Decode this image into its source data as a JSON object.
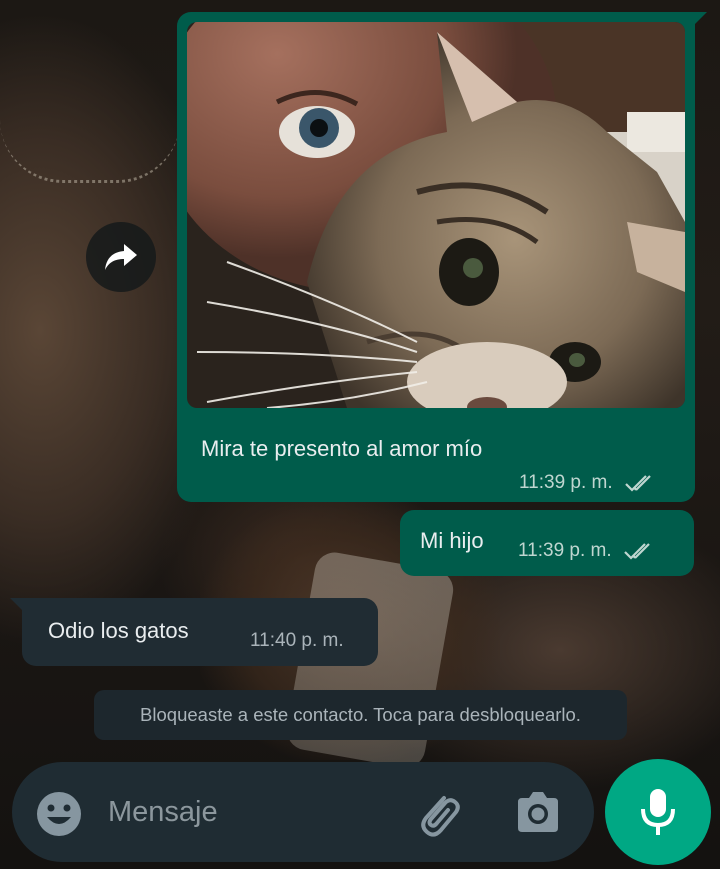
{
  "chat": {
    "messages": [
      {
        "direction": "outgoing",
        "type": "photo",
        "caption": "Mira te presento al amor mío",
        "time": "11:39 p. m.",
        "status": "delivered-double-check"
      },
      {
        "direction": "outgoing",
        "type": "text",
        "text": "Mi hijo",
        "time": "11:39 p. m.",
        "status": "delivered-double-check"
      },
      {
        "direction": "incoming",
        "type": "text",
        "text": "Odio los gatos",
        "time": "11:40 p. m."
      }
    ],
    "system_notice": "Bloqueaste a este contacto. Toca para desbloquearlo."
  },
  "composer": {
    "placeholder": "Mensaje",
    "icons": {
      "emoji": "emoji-icon",
      "attach": "paperclip-icon",
      "camera": "camera-icon",
      "voice": "microphone-icon"
    }
  },
  "actions": {
    "forward": "forward-arrow-icon"
  },
  "colors": {
    "outgoing_bubble": "#005c4b",
    "incoming_bubble": "#202c33",
    "composer_bg": "#1f2c33",
    "mic_button": "#00a884",
    "text_primary": "#e9edef",
    "text_meta": "#aab4ba"
  }
}
